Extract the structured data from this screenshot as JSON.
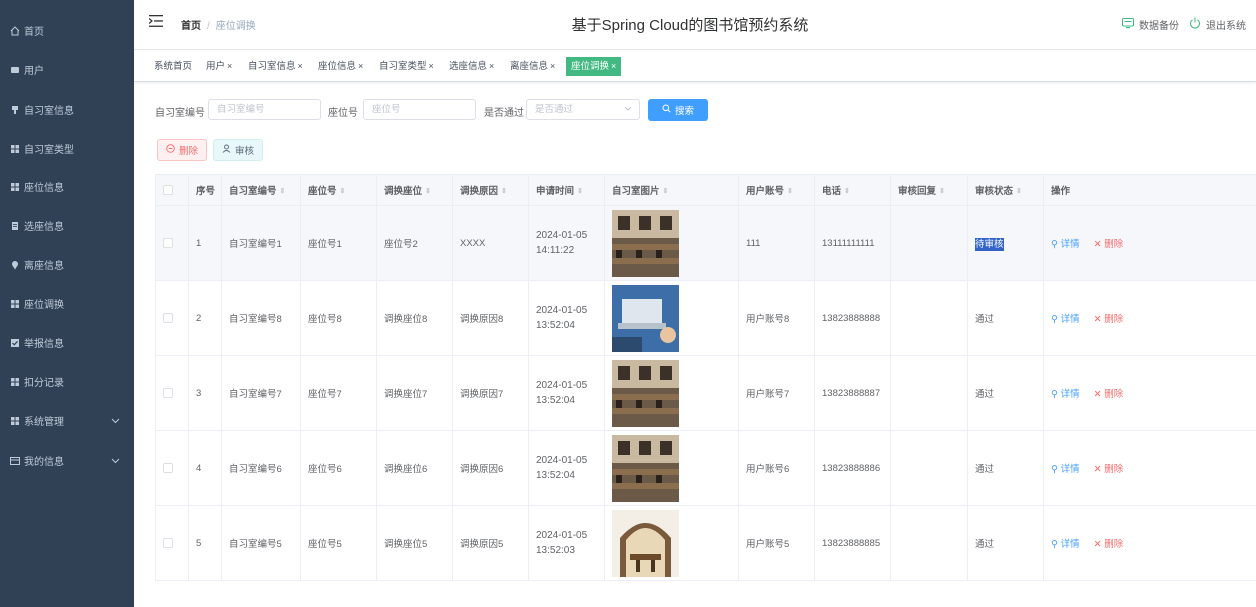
{
  "colors": {
    "sidebar_bg": "#304156",
    "primary": "#409eff",
    "active_tag": "#42b983",
    "danger": "#f56c6c"
  },
  "sidebar": {
    "items": [
      {
        "label": "首页",
        "icon": "home-icon"
      },
      {
        "label": "用户",
        "icon": "user-icon"
      },
      {
        "label": "自习室信息",
        "icon": "pin-icon"
      },
      {
        "label": "自习室类型",
        "icon": "grid-icon"
      },
      {
        "label": "座位信息",
        "icon": "grid-icon"
      },
      {
        "label": "选座信息",
        "icon": "doc-icon"
      },
      {
        "label": "离座信息",
        "icon": "location-icon"
      },
      {
        "label": "座位调换",
        "icon": "grid-icon"
      },
      {
        "label": "举报信息",
        "icon": "check-icon"
      },
      {
        "label": "扣分记录",
        "icon": "grid-icon"
      },
      {
        "label": "系统管理",
        "icon": "grid-icon"
      },
      {
        "label": "我的信息",
        "icon": "card-icon"
      }
    ]
  },
  "header": {
    "breadcrumb_home": "首页",
    "breadcrumb_sep": "/",
    "breadcrumb_current": "座位调换",
    "title": "基于Spring Cloud的图书馆预约系统",
    "backup_label": "数据备份",
    "logout_label": "退出系统"
  },
  "tags": [
    {
      "label": "系统首页",
      "closable": false
    },
    {
      "label": "用户",
      "closable": true
    },
    {
      "label": "自习室信息",
      "closable": true
    },
    {
      "label": "座位信息",
      "closable": true
    },
    {
      "label": "自习室类型",
      "closable": true
    },
    {
      "label": "选座信息",
      "closable": true
    },
    {
      "label": "离座信息",
      "closable": true
    },
    {
      "label": "座位调换",
      "closable": true,
      "active": true
    }
  ],
  "tag_close": "×",
  "search": {
    "room_label": "自习室编号",
    "room_placeholder": "自习室编号",
    "seat_label": "座位号",
    "seat_placeholder": "座位号",
    "pass_label": "是否通过",
    "pass_placeholder": "是否通过",
    "button": "搜索"
  },
  "actions": {
    "delete": "删除",
    "audit": "审核"
  },
  "table": {
    "columns": [
      "",
      "序号",
      "自习室编号",
      "座位号",
      "调换座位",
      "调换原因",
      "申请时间",
      "自习室图片",
      "用户账号",
      "电话",
      "审核回复",
      "审核状态",
      "操作"
    ],
    "detail_label": "详情",
    "delete_label": "删除",
    "rows": [
      {
        "no": "1",
        "room": "自习室编号1",
        "seat": "座位号1",
        "swap": "座位号2",
        "reason": "XXXX",
        "time": "2024-01-05 14:11:22",
        "image": "study-room-photo",
        "account": "111",
        "phone": "13111111111",
        "reply": "",
        "status": "待审核"
      },
      {
        "no": "2",
        "room": "自习室编号8",
        "seat": "座位号8",
        "swap": "调换座位8",
        "reason": "调换原因8",
        "time": "2024-01-05 13:52:04",
        "image": "laptop-photo",
        "account": "用户账号8",
        "phone": "13823888888",
        "reply": "",
        "status": "通过"
      },
      {
        "no": "3",
        "room": "自习室编号7",
        "seat": "座位号7",
        "swap": "调换座位7",
        "reason": "调换原因7",
        "time": "2024-01-05 13:52:04",
        "image": "study-room-photo",
        "account": "用户账号7",
        "phone": "13823888887",
        "reply": "",
        "status": "通过"
      },
      {
        "no": "4",
        "room": "自习室编号6",
        "seat": "座位号6",
        "swap": "调换座位6",
        "reason": "调换原因6",
        "time": "2024-01-05 13:52:04",
        "image": "study-room-photo",
        "account": "用户账号6",
        "phone": "13823888886",
        "reply": "",
        "status": "通过"
      },
      {
        "no": "5",
        "room": "自习室编号5",
        "seat": "座位号5",
        "swap": "调换座位5",
        "reason": "调换原因5",
        "time": "2024-01-05 13:52:03",
        "image": "arched-room-photo",
        "account": "用户账号5",
        "phone": "13823888885",
        "reply": "",
        "status": "通过"
      }
    ]
  }
}
